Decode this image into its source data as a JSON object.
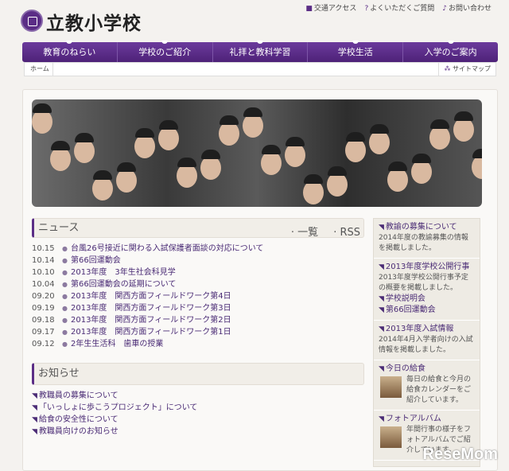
{
  "header": {
    "title": "立教小学校",
    "top_links": [
      {
        "icon": "train-icon",
        "label": "交通アクセス"
      },
      {
        "icon": "question-icon",
        "label": "よくいただくご質問"
      },
      {
        "icon": "note-icon",
        "label": "お問い合わせ"
      }
    ]
  },
  "nav": [
    "教育のねらい",
    "学校のご紹介",
    "礼拝と教科学習",
    "学校生活",
    "入学のご案内"
  ],
  "breadcrumb": {
    "home": "ホーム",
    "sitemap": "サイトマップ"
  },
  "news": {
    "title": "ニュース",
    "list_link": "一覧",
    "rss_link": "RSS",
    "items": [
      {
        "date": "10.15",
        "title": "台風26号接近に関わる入試保護者面談の対応について"
      },
      {
        "date": "10.14",
        "title": "第66回運動会"
      },
      {
        "date": "10.10",
        "title": "2013年度　3年生社会科見学"
      },
      {
        "date": "10.04",
        "title": "第66回運動会の延期について"
      },
      {
        "date": "09.20",
        "title": "2013年度　関西方面フィールドワーク第4日"
      },
      {
        "date": "09.19",
        "title": "2013年度　関西方面フィールドワーク第3日"
      },
      {
        "date": "09.18",
        "title": "2013年度　関西方面フィールドワーク第2日"
      },
      {
        "date": "09.17",
        "title": "2013年度　関西方面フィールドワーク第1日"
      },
      {
        "date": "09.12",
        "title": "2年生生活科　歯車の授業"
      }
    ]
  },
  "notices": {
    "title": "お知らせ",
    "items": [
      "教職員の募集について",
      "「いっしょに歩こうプロジェクト」について",
      "給食の安全性について",
      "教職員向けのお知らせ"
    ]
  },
  "sidebar": [
    {
      "title": "教諭の募集について",
      "text": "2014年度の教諭募集の情報を掲載しました。"
    },
    {
      "title": "2013年度学校公開行事",
      "text": "2013年度学校公開行事予定の概要を掲載しました。",
      "links": [
        "学校説明会",
        "第66回運動会"
      ]
    },
    {
      "title": "2013年度入試情報",
      "text": "2014年4月入学者向けの入試情報を掲載しました。"
    },
    {
      "title": "今日の給食",
      "text": "毎日の給食と今月の給食カレンダーをご紹介しています。"
    },
    {
      "title": "フォトアルバム",
      "text": "年間行事の様子をフォトアルバムでご紹介しています。"
    }
  ],
  "watermark": "ReseMom"
}
